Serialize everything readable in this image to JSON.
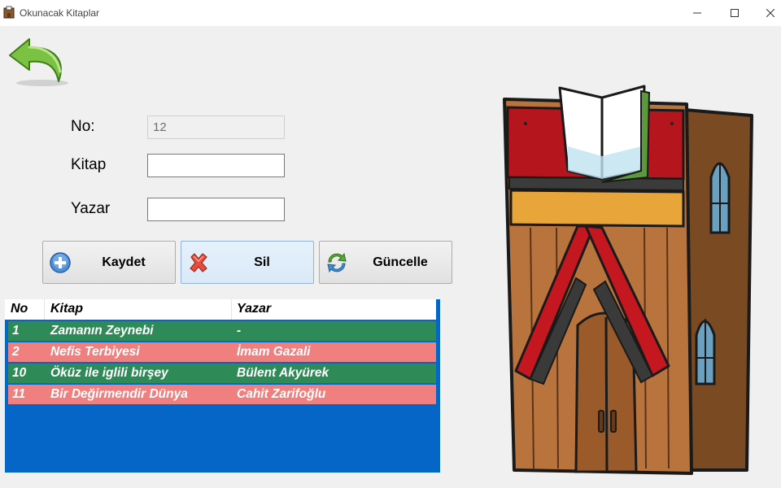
{
  "window": {
    "title": "Okunacak Kitaplar"
  },
  "form": {
    "no_label": "No:",
    "no_value": "12",
    "kitap_label": "Kitap",
    "kitap_value": "",
    "yazar_label": "Yazar",
    "yazar_value": ""
  },
  "buttons": {
    "save": "Kaydet",
    "delete": "Sil",
    "update": "Güncelle"
  },
  "table": {
    "headers": [
      "No",
      "Kitap",
      "Yazar"
    ],
    "rows": [
      {
        "no": "1",
        "kitap": "Zamanın Zeynebi",
        "yazar": "-",
        "color": "#2e8b57"
      },
      {
        "no": "2",
        "kitap": "Nefis Terbiyesi",
        "yazar": "İmam Gazali",
        "color": "#f08080"
      },
      {
        "no": "10",
        "kitap": "Öküz ile iglili birşey",
        "yazar": "Bülent Akyürek",
        "color": "#2e8b57"
      },
      {
        "no": "11",
        "kitap": "Bir Değirmendir Dünya",
        "yazar": "Cahit Zarifoğlu",
        "color": "#f08080"
      }
    ],
    "background": "#0566c8"
  },
  "icons": {
    "back": "back-arrow-icon",
    "save": "add-circle-icon",
    "delete": "red-x-icon",
    "update": "refresh-icon",
    "illustration": "library-building-icon"
  }
}
